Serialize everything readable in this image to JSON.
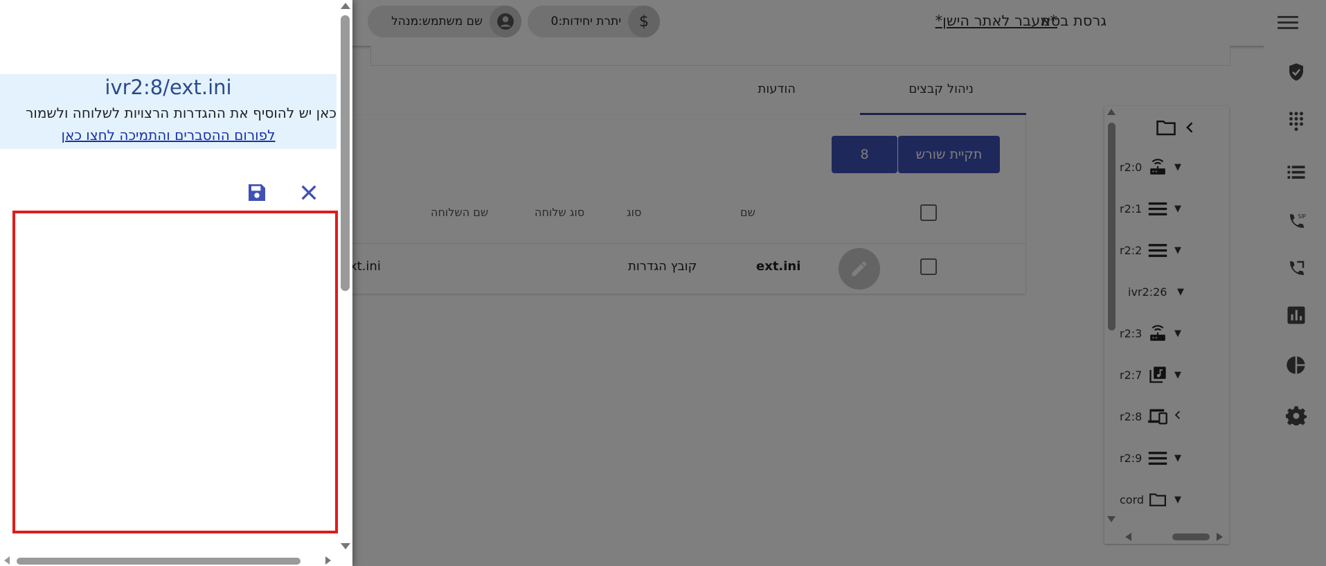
{
  "header": {
    "version_label": "גרסת בטא",
    "old_site_link": "*מעבר לאתר הישן*",
    "units_label": "יתרת יחידות:0",
    "username_label": "שם משתמש:מנהל",
    "units_icon": "dollar-icon",
    "user_icon": "account-circle-icon"
  },
  "tabs": [
    {
      "label": "ניהול קבצים"
    },
    {
      "label": "הודעות"
    }
  ],
  "toolbar": {
    "root_button": "תקיית שורש",
    "path_button": "8"
  },
  "table": {
    "columns": [
      "שם",
      "סוג",
      "סוג שלוחה",
      "שם השלוחה"
    ],
    "rows": [
      {
        "name": "ext.ini",
        "type": "קובץ הגדרות",
        "ext_type": "",
        "ext_name": "xt.ini"
      }
    ]
  },
  "tree": {
    "items": [
      {
        "label": "r2:0",
        "icon": "router-icon"
      },
      {
        "label": "r2:1",
        "icon": "menu-lines-icon"
      },
      {
        "label": "r2:2",
        "icon": "menu-lines-icon"
      },
      {
        "label": "ivr2:26",
        "icon": ""
      },
      {
        "label": "r2:3",
        "icon": "router-icon"
      },
      {
        "label": "r2:7",
        "icon": "music-library-icon"
      },
      {
        "label": "r2:8",
        "icon": "devices-icon"
      },
      {
        "label": "r2:9",
        "icon": "menu-lines-icon"
      },
      {
        "label": "cord",
        "icon": "folder-icon"
      }
    ]
  },
  "drawer": {
    "file_title": "ivr2:8/ext.ini",
    "description": "כאן יש להוסיף את ההגדרות הרצויות לשלוחה ולשמור",
    "forum_link": "לפורום ההסברים והתמיכה לחצו כאן",
    "editor_value": ""
  },
  "colors": {
    "primary": "#3f51b5",
    "info_bg": "#e3f2fd",
    "editor_border": "#e01a1a"
  }
}
